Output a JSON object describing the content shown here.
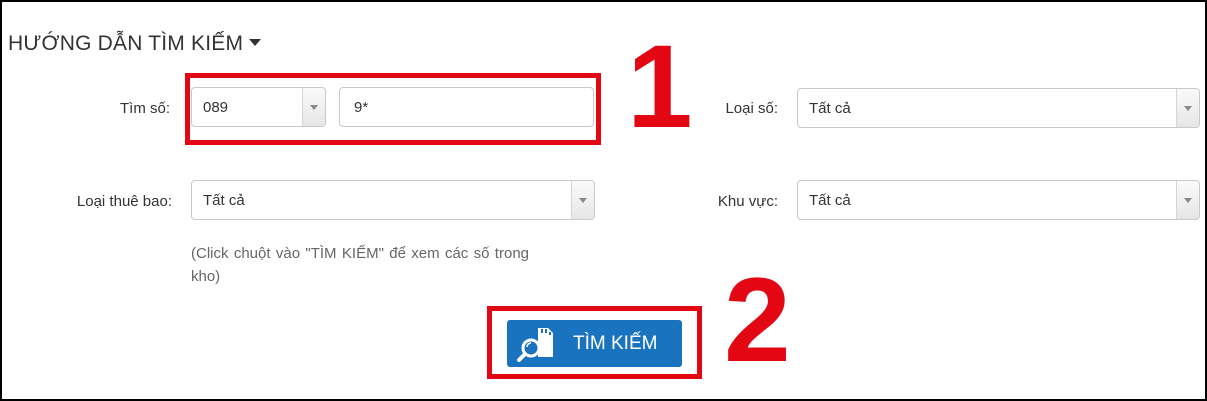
{
  "heading": "HƯỚNG DẪN TÌM KIẾM",
  "form": {
    "tim_so": {
      "label": "Tìm số:",
      "prefix": "089",
      "pattern": "9*"
    },
    "loai_so": {
      "label": "Loại số:",
      "value": "Tất cả"
    },
    "loai_thue_bao": {
      "label": "Loại thuê bao:",
      "value": "Tất cả"
    },
    "khu_vuc": {
      "label": "Khu vực:",
      "value": "Tất cả"
    },
    "hint": "(Click chuột vào \"TÌM KIẾM\" để xem các số trong kho)"
  },
  "search_button": {
    "label": "TÌM KIẾM",
    "icon": "search-icon"
  },
  "annotations": {
    "step1": "1",
    "step2": "2"
  },
  "colors": {
    "accent_red": "#e30613",
    "button_blue": "#1a73be"
  }
}
